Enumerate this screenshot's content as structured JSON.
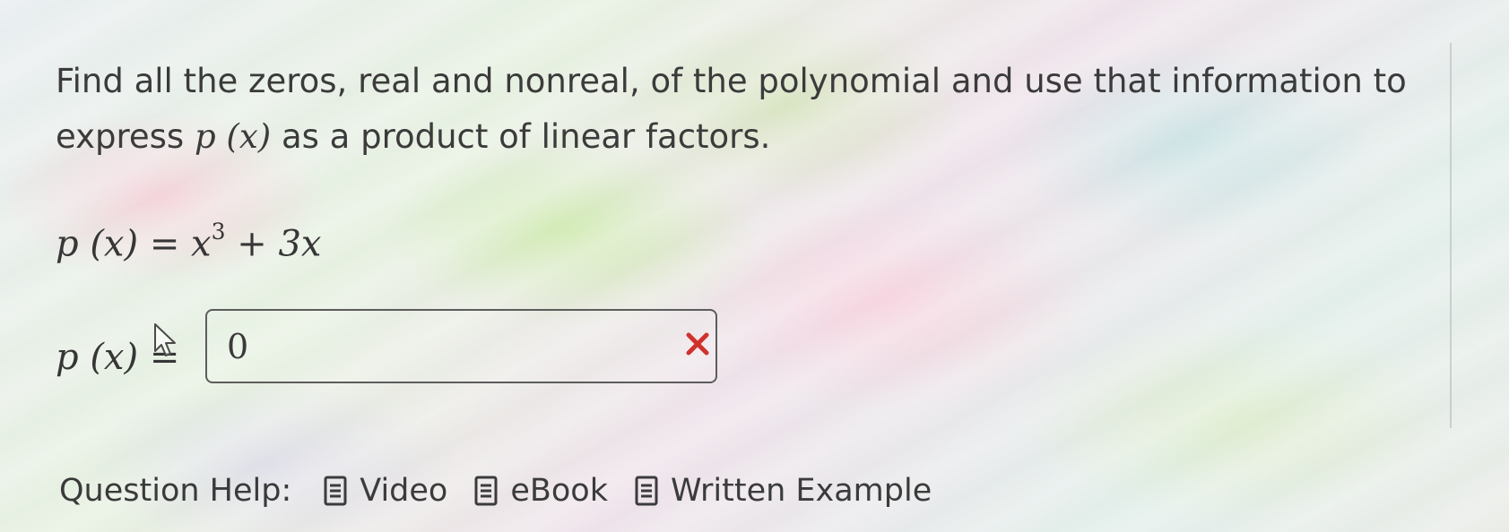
{
  "question": {
    "prompt_part1": "Find all the zeros, real and nonreal, of the polynomial and use that information to express",
    "prompt_math": "p (x)",
    "prompt_part2": "as a product of linear factors."
  },
  "equation": {
    "lhs": "p (x)",
    "equals": "=",
    "term1_base": "x",
    "term1_exp": "3",
    "plus": "+",
    "term2": "3x"
  },
  "answer": {
    "label": "p (x)",
    "equals": "=",
    "value": "0",
    "status": "incorrect",
    "status_icon": "close-x-icon",
    "status_color": "#d0312d"
  },
  "help": {
    "label": "Question Help:",
    "links": [
      {
        "label": "Video",
        "icon": "document-icon"
      },
      {
        "label": "eBook",
        "icon": "document-icon"
      },
      {
        "label": "Written Example",
        "icon": "document-icon"
      }
    ]
  }
}
